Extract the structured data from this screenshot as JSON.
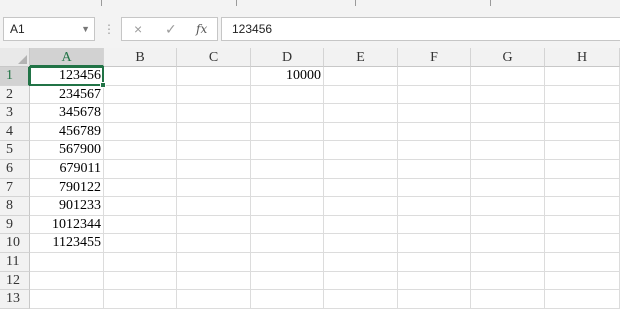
{
  "name_box": {
    "value": "A1",
    "dropdown_icon": "chevron-down-icon"
  },
  "formula_bar": {
    "cancel_icon": "×",
    "enter_icon": "✓",
    "fx_label": "fx",
    "content": "123456"
  },
  "columns": [
    "A",
    "B",
    "C",
    "D",
    "E",
    "F",
    "G",
    "H"
  ],
  "rows": [
    "1",
    "2",
    "3",
    "4",
    "5",
    "6",
    "7",
    "8",
    "9",
    "10",
    "11",
    "12",
    "13"
  ],
  "selected_cell": "A1",
  "cells": {
    "A1": "123456",
    "A2": "234567",
    "A3": "345678",
    "A4": "456789",
    "A5": "567900",
    "A6": "679011",
    "A7": "790122",
    "A8": "901233",
    "A9": "1012344",
    "A10": "1123455",
    "D1": "10000"
  },
  "colors": {
    "accent": "#217346"
  }
}
